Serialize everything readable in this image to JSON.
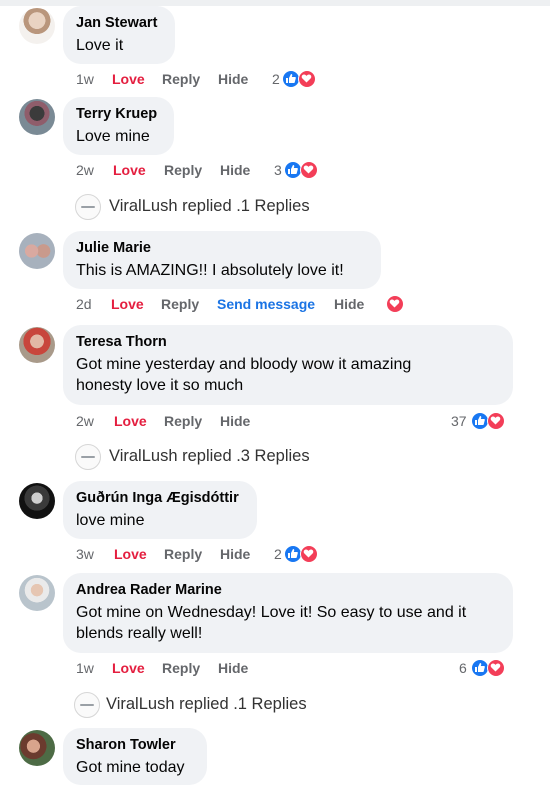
{
  "actions": {
    "love": "Love",
    "reply": "Reply",
    "hide": "Hide",
    "send_message": "Send message"
  },
  "colors": {
    "love_red": "#e41e3f",
    "link_blue": "#1b74e4",
    "like_blue": "#1877f2",
    "heart_red": "#f33e58",
    "bubble_bg": "#f0f2f5"
  },
  "comments": [
    {
      "name": "Jan Stewart",
      "text": "Love it",
      "time": "1w",
      "reactions": "2",
      "reaction_icons": [
        "like-icon",
        "heart-icon"
      ]
    },
    {
      "name": "Terry Kruep",
      "text": "Love mine",
      "time": "2w",
      "reactions": "3",
      "reaction_icons": [
        "like-icon",
        "heart-icon"
      ]
    },
    {
      "name": "Julie Marie",
      "text": "This is AMAZING!! I absolutely love it!",
      "time": "2d",
      "reaction_icons": [
        "heart-icon"
      ]
    },
    {
      "name": "Teresa Thorn",
      "text_lines": [
        "Got mine yesterday and bloody wow it amazing",
        "honesty love it so much"
      ],
      "time": "2w",
      "reactions": "37",
      "reaction_icons": [
        "like-icon",
        "heart-icon"
      ]
    },
    {
      "name": "Guðrún Inga Ægisdóttir",
      "text": "love mine",
      "time": "3w",
      "reactions": "2",
      "reaction_icons": [
        "like-icon",
        "heart-icon"
      ]
    },
    {
      "name": "Andrea Rader Marine",
      "text_lines": [
        "Got mine on Wednesday! Love it! So easy to use and it",
        "blends really well!"
      ],
      "time": "1w",
      "reactions": "6",
      "reaction_icons": [
        "like-icon",
        "heart-icon"
      ]
    },
    {
      "name": "Sharon Towler",
      "text": "Got mine today"
    }
  ],
  "replies": [
    {
      "author": "ViralLush",
      "text": "replied .1 Replies"
    },
    {
      "author": "ViralLush",
      "text": "replied .3 Replies"
    },
    {
      "author": "ViralLush",
      "text": "replied .1 Replies"
    }
  ]
}
